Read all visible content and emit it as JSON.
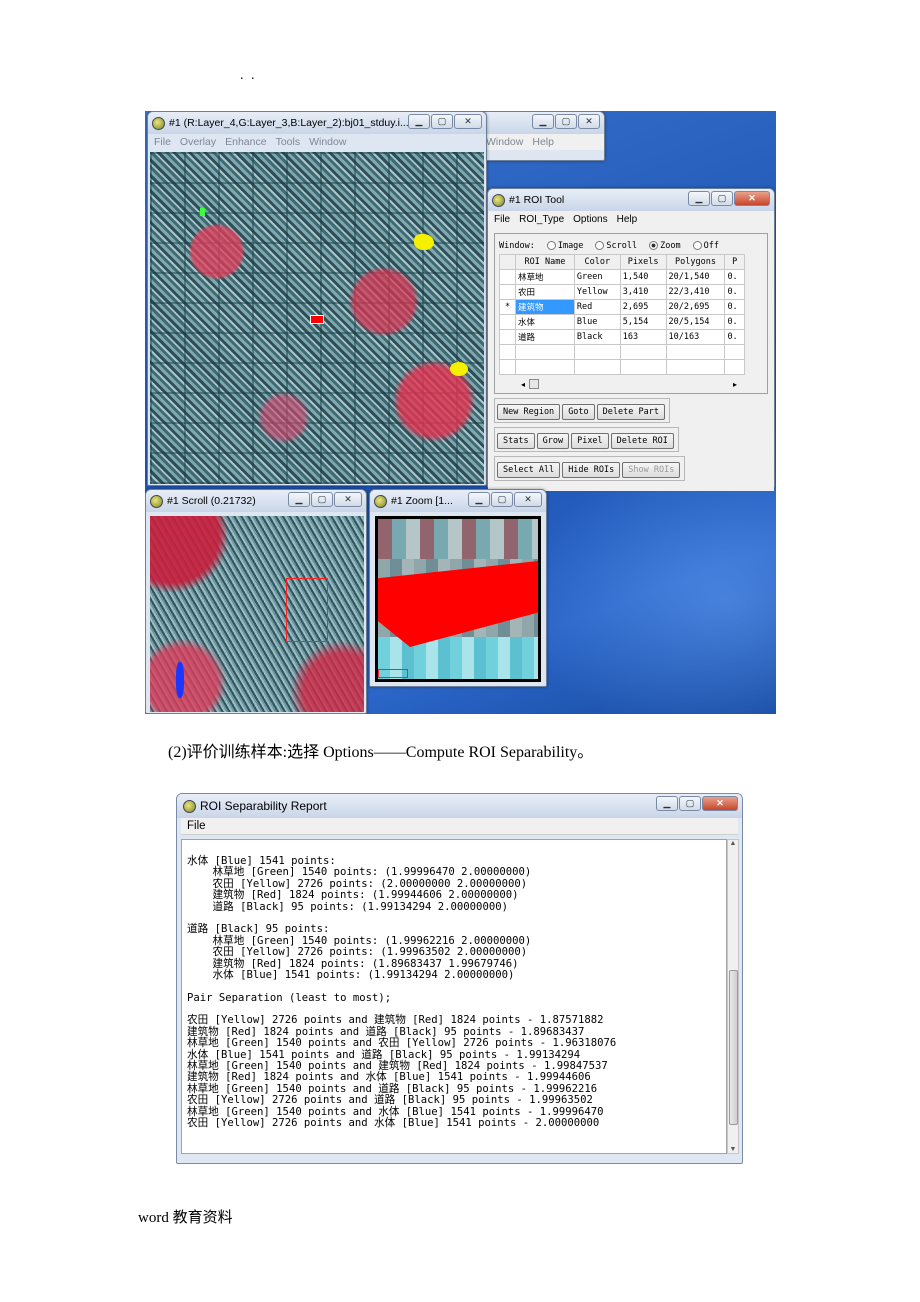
{
  "header_dots": ". .",
  "screenshot1": {
    "main_window": {
      "title": "#1 (R:Layer_4,G:Layer_3,B:Layer_2):bj01_stduy.i...",
      "menu": [
        "File",
        "Overlay",
        "Enhance",
        "Tools",
        "Window"
      ]
    },
    "back_window": {
      "menu": [
        "Window",
        "Help"
      ]
    },
    "roi_tool": {
      "title": "#1 ROI Tool",
      "menu": [
        "File",
        "ROI_Type",
        "Options",
        "Help"
      ],
      "window_label": "Window:",
      "radios": [
        {
          "label": "Image",
          "on": false
        },
        {
          "label": "Scroll",
          "on": false
        },
        {
          "label": "Zoom",
          "on": true
        },
        {
          "label": "Off",
          "on": false
        }
      ],
      "columns": [
        "ROI Name",
        "Color",
        "Pixels",
        "Polygons",
        "P"
      ],
      "rows": [
        {
          "mark": "",
          "name": "林草地",
          "color": "Green",
          "pixels": "1,540",
          "polygons": "20/1,540",
          "p": "0."
        },
        {
          "mark": "",
          "name": "农田",
          "color": "Yellow",
          "pixels": "3,410",
          "polygons": "22/3,410",
          "p": "0."
        },
        {
          "mark": "*",
          "name": "建筑物",
          "color": "Red",
          "pixels": "2,695",
          "polygons": "20/2,695",
          "p": "0."
        },
        {
          "mark": "",
          "name": "水体",
          "color": "Blue",
          "pixels": "5,154",
          "polygons": "20/5,154",
          "p": "0."
        },
        {
          "mark": "",
          "name": "道路",
          "color": "Black",
          "pixels": "163",
          "polygons": "10/163",
          "p": "0."
        }
      ],
      "buttons_row1": [
        "New Region",
        "Goto",
        "Delete Part"
      ],
      "buttons_row2": [
        "Stats",
        "Grow",
        "Pixel",
        "Delete ROI"
      ],
      "buttons_row3": [
        "Select All",
        "Hide ROIs",
        "Show ROIs"
      ]
    },
    "scroll_window": {
      "title": "#1 Scroll (0.21732)"
    },
    "zoom_window": {
      "title": "#1 Zoom [1..."
    }
  },
  "caption": "(2)评价训练样本:选择 Options——Compute ROI Separability。",
  "report": {
    "title": "ROI Separability Report",
    "menu": "File",
    "lines": [
      "水体 [Blue] 1541 points:",
      "    林草地 [Green] 1540 points: (1.99996470 2.00000000)",
      "    农田 [Yellow] 2726 points: (2.00000000 2.00000000)",
      "    建筑物 [Red] 1824 points: (1.99944606 2.00000000)",
      "    道路 [Black] 95 points: (1.99134294 2.00000000)",
      "",
      "道路 [Black] 95 points:",
      "    林草地 [Green] 1540 points: (1.99962216 2.00000000)",
      "    农田 [Yellow] 2726 points: (1.99963502 2.00000000)",
      "    建筑物 [Red] 1824 points: (1.89683437 1.99679746)",
      "    水体 [Blue] 1541 points: (1.99134294 2.00000000)",
      "",
      "Pair Separation (least to most);",
      "",
      "农田 [Yellow] 2726 points and 建筑物 [Red] 1824 points - 1.87571882",
      "建筑物 [Red] 1824 points and 道路 [Black] 95 points - 1.89683437",
      "林草地 [Green] 1540 points and 农田 [Yellow] 2726 points - 1.96318076",
      "水体 [Blue] 1541 points and 道路 [Black] 95 points - 1.99134294",
      "林草地 [Green] 1540 points and 建筑物 [Red] 1824 points - 1.99847537",
      "建筑物 [Red] 1824 points and 水体 [Blue] 1541 points - 1.99944606",
      "林草地 [Green] 1540 points and 道路 [Black] 95 points - 1.99962216",
      "农田 [Yellow] 2726 points and 道路 [Black] 95 points - 1.99963502",
      "林草地 [Green] 1540 points and 水体 [Blue] 1541 points - 1.99996470",
      "农田 [Yellow] 2726 points and 水体 [Blue] 1541 points - 2.00000000"
    ]
  },
  "footer": "word 教育资料"
}
